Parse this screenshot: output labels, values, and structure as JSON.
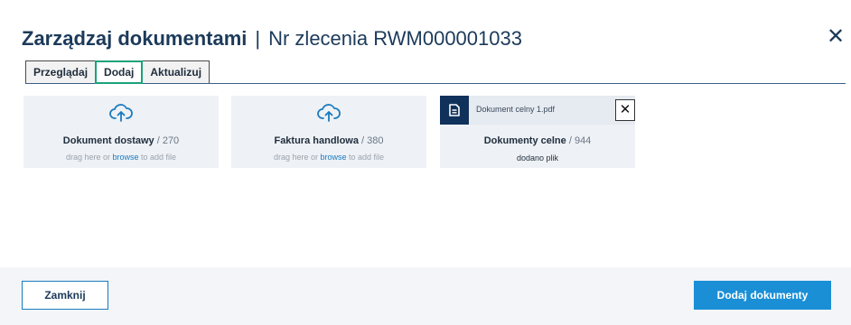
{
  "header": {
    "title": "Zarządzaj dokumentami",
    "separator": "|",
    "order_label": "Nr zlecenia RWM000001033"
  },
  "close_label": "✕",
  "tabs": [
    {
      "label": "Przeglądaj",
      "active": false
    },
    {
      "label": "Dodaj",
      "active": true
    },
    {
      "label": "Aktualizuj",
      "active": false
    }
  ],
  "cards": [
    {
      "title": "Dokument dostawy",
      "count": " / 270",
      "hint_prefix": "drag here or ",
      "hint_link": "browse",
      "hint_suffix": " to add file",
      "icon": "cloud-upload-icon"
    },
    {
      "title": "Faktura handlowa",
      "count": " / 380",
      "hint_prefix": "drag here or ",
      "hint_link": "browse",
      "hint_suffix": " to add file",
      "icon": "cloud-upload-icon"
    },
    {
      "title": "Dokumenty celne",
      "count": " / 944",
      "file_name": "Dokument celny 1.pdf",
      "remove_label": "✕",
      "status": "dodano plik",
      "icon": "document-icon"
    }
  ],
  "footer": {
    "close_button": "Zamknij",
    "submit_button": "Dodaj dokumenty"
  },
  "colors": {
    "accent": "#1a8fd6",
    "active_tab_border": "#1aa37a",
    "navy": "#10325a",
    "link": "#1a7bbf"
  }
}
